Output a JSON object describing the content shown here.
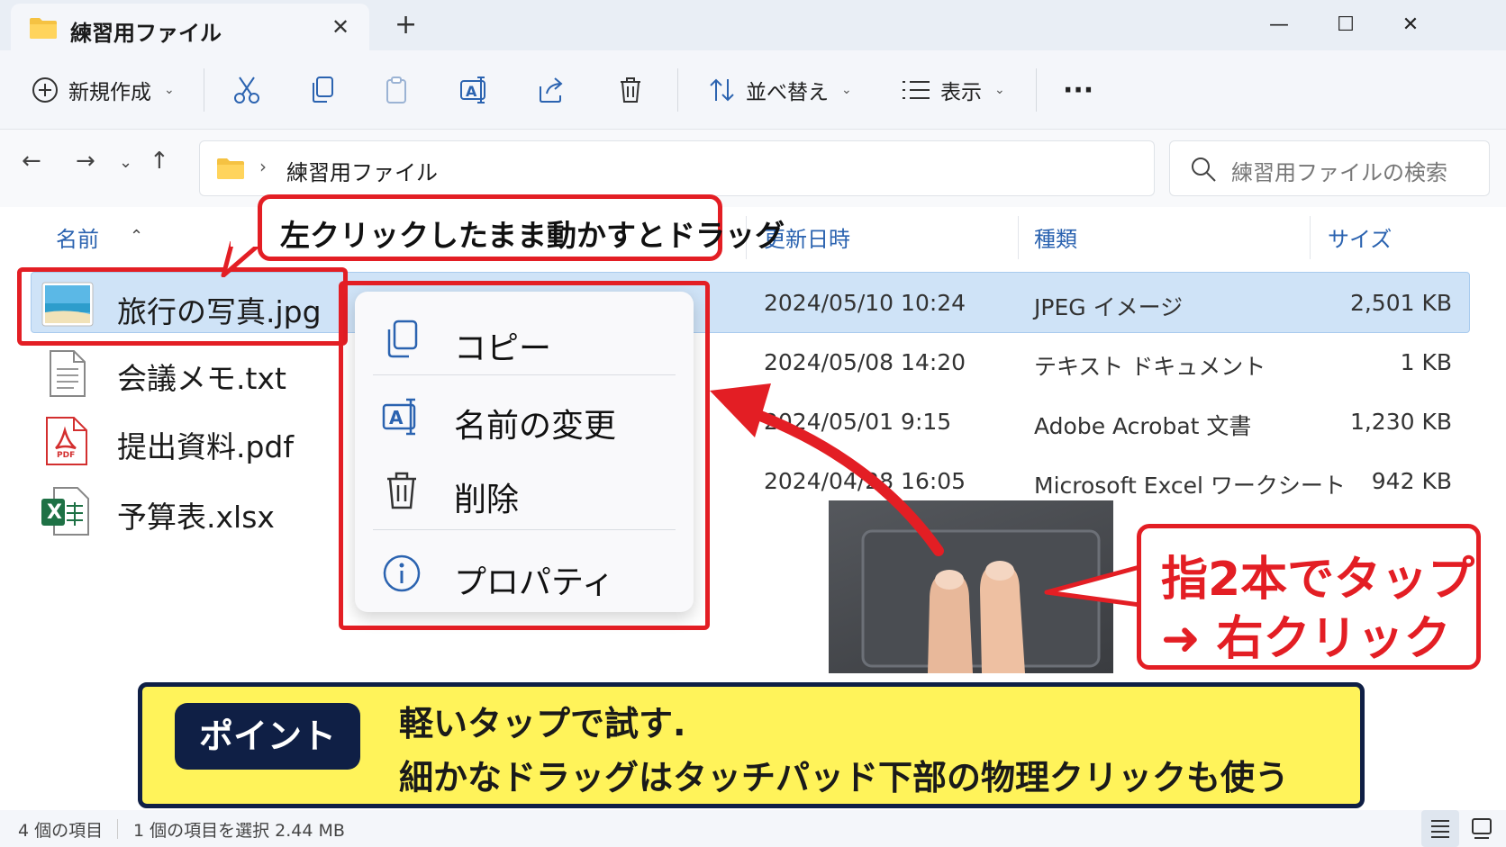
{
  "tab": {
    "title": "練習用ファイル",
    "close": "✕",
    "add": "+"
  },
  "window_controls": {
    "minimize": "—",
    "maximize": "☐",
    "close": "✕"
  },
  "toolbar": {
    "new_label": "新規作成",
    "sort_label": "並べ替え",
    "view_label": "表示",
    "more_label": "···",
    "chevron": "⌄"
  },
  "nav": {
    "back": "←",
    "forward": "→",
    "recent": "⌄",
    "up": "↑",
    "breadcrumb_sep": "›"
  },
  "address": {
    "folder": "練習用ファイル"
  },
  "search": {
    "placeholder": "練習用ファイルの検索"
  },
  "columns": {
    "name": "名前",
    "sort_indicator": "⌃",
    "modified": "更新日時",
    "type": "種類",
    "size": "サイズ"
  },
  "files": [
    {
      "name": "旅行の写真.jpg",
      "modified": "2024/05/10 10:24",
      "type": "JPEG イメージ",
      "size": "2,501 KB",
      "icon": "image-icon",
      "selected": true
    },
    {
      "name": "会議メモ.txt",
      "modified": "2024/05/08 14:20",
      "type": "テキスト ドキュメント",
      "size": "1 KB",
      "icon": "text-file-icon",
      "selected": false
    },
    {
      "name": "提出資料.pdf",
      "modified": "2024/05/01 9:15",
      "type": "Adobe Acrobat 文書",
      "size": "1,230 KB",
      "icon": "pdf-icon",
      "selected": false
    },
    {
      "name": "予算表.xlsx",
      "modified": "2024/04/28 16:05",
      "type": "Microsoft Excel ワークシート",
      "size": "942 KB",
      "icon": "excel-icon",
      "selected": false
    }
  ],
  "context_menu": {
    "copy": "コピー",
    "rename": "名前の変更",
    "delete": "削除",
    "properties": "プロパティ"
  },
  "callouts": {
    "drag": "左クリックしたまま動かすとドラッグ",
    "two_finger_line1": "指2本でタップ",
    "two_finger_line2": "➜ 右クリック"
  },
  "point": {
    "badge": "ポイント",
    "line1": "軽いタップで試す.",
    "line2": "細かなドラッグはタッチパッド下部の物理クリックも使う"
  },
  "status": {
    "count": "4 個の項目",
    "selection": "1 個の項目を選択  2.44 MB"
  },
  "colors": {
    "accent_red": "#e31e24",
    "selection_blue": "#cfe3f7",
    "banner_yellow": "#fff35a",
    "banner_navy": "#0f1f45",
    "header_blue": "#2b63b0"
  },
  "pdf_badge": "PDF",
  "excel_badge": "X"
}
